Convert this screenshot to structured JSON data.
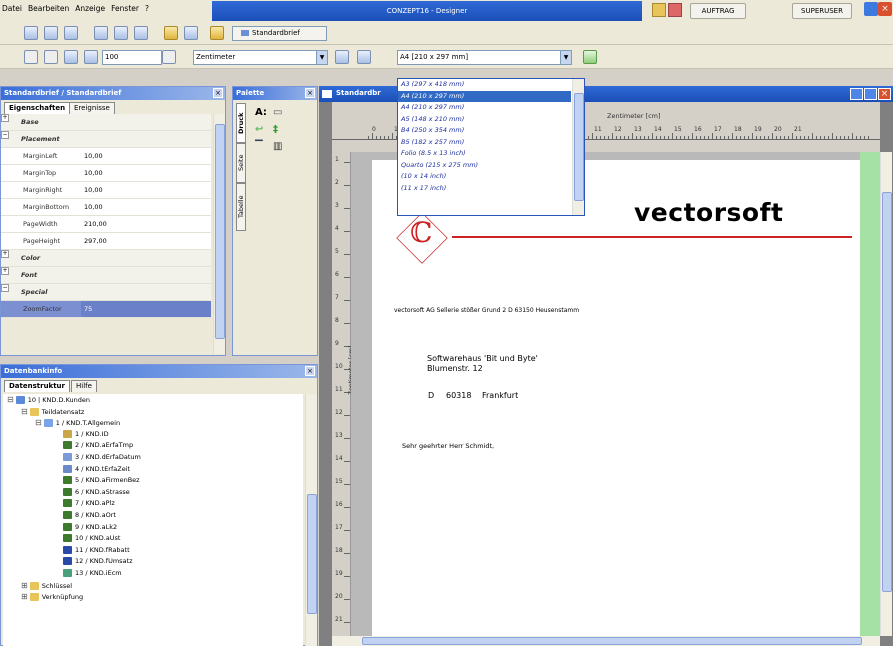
{
  "menu": [
    "Datei",
    "Bearbeiten",
    "Anzeige",
    "Fenster",
    "?"
  ],
  "app_title": "CONZEPT16 - Designer",
  "title_buttons": {
    "auftrag": "AUFTRAG",
    "superuser": "SUPERUSER"
  },
  "toolbar1": {
    "doc_selector": "Standardbrief"
  },
  "toolbar2": {
    "zoom": "100",
    "unit": "Zentimeter",
    "paper_format": "A4 [210 x 297 mm]"
  },
  "paper_dropdown": {
    "options": [
      "A3 (297 x 418 mm)",
      "A4 (210 x 297 mm)",
      "A4 (210 x 297 mm)",
      "A5 (148 x 210 mm)",
      "B4 (250 x 354 mm)",
      "B5 (182 x 257 mm)",
      "Folio (8.5 x 13 inch)",
      "Quarto (215 x 275 mm)",
      "(10 x 14 inch)",
      "(11 x 17 inch)"
    ],
    "selected_index": 1
  },
  "properties_panel": {
    "title": "Standardbrief / Standardbrief",
    "tabs": [
      "Eigenschaften",
      "Ereignisse"
    ],
    "rows": [
      {
        "key": "Base",
        "value": "",
        "type": "cat",
        "expander": "+"
      },
      {
        "key": "Placement",
        "value": "",
        "type": "cat",
        "expander": "−"
      },
      {
        "key": "MarginLeft",
        "value": "10,00",
        "type": "prop"
      },
      {
        "key": "MarginTop",
        "value": "10,00",
        "type": "prop"
      },
      {
        "key": "MarginRight",
        "value": "10,00",
        "type": "prop"
      },
      {
        "key": "MarginBottom",
        "value": "10,00",
        "type": "prop"
      },
      {
        "key": "PageWidth",
        "value": "210,00",
        "type": "prop"
      },
      {
        "key": "PageHeight",
        "value": "297,00",
        "type": "prop"
      },
      {
        "key": "Color",
        "value": "",
        "type": "cat",
        "expander": "+"
      },
      {
        "key": "Font",
        "value": "",
        "type": "cat",
        "expander": "+"
      },
      {
        "key": "Special",
        "value": "",
        "type": "cat",
        "expander": "−"
      },
      {
        "key": "ZoomFactor",
        "value": "75",
        "type": "sel"
      }
    ]
  },
  "palette_panel": {
    "title": "Palette",
    "vtabs": [
      "Druck",
      "Seite",
      "Tabelle"
    ],
    "tools": [
      "A:",
      "▭",
      "↩",
      "‡",
      "▔",
      "▥"
    ]
  },
  "db_panel": {
    "title": "Datenbankinfo",
    "tabs": [
      "Datenstruktur",
      "Hilfe"
    ],
    "tree": [
      {
        "label": "10 | KND.D.Kunden",
        "indent": 0,
        "exp": "⊟",
        "icon": "db"
      },
      {
        "label": "Teildatensatz",
        "indent": 1,
        "exp": "⊟",
        "icon": "folder"
      },
      {
        "label": "1 / KND.T.Allgemein",
        "indent": 2,
        "exp": "⊟",
        "icon": "table"
      },
      {
        "label": "1 / KND.ID",
        "indent": 4,
        "exp": "",
        "icon": "key"
      },
      {
        "label": "2 / KND.aErfaTmp",
        "indent": 4,
        "exp": "",
        "icon": "alpha"
      },
      {
        "label": "3 / KND.dErfaDatum",
        "indent": 4,
        "exp": "",
        "icon": "cal"
      },
      {
        "label": "4 / KND.tErfaZeit",
        "indent": 4,
        "exp": "",
        "icon": "clock"
      },
      {
        "label": "5 / KND.aFirmenBez",
        "indent": 4,
        "exp": "",
        "icon": "alpha"
      },
      {
        "label": "6 / KND.aStrasse",
        "indent": 4,
        "exp": "",
        "icon": "alpha"
      },
      {
        "label": "7 / KND.aPlz",
        "indent": 4,
        "exp": "",
        "icon": "alpha"
      },
      {
        "label": "8 / KND.aOrt",
        "indent": 4,
        "exp": "",
        "icon": "alpha"
      },
      {
        "label": "9 / KND.aLk2",
        "indent": 4,
        "exp": "",
        "icon": "alpha"
      },
      {
        "label": "10 / KND.aUst",
        "indent": 4,
        "exp": "",
        "icon": "alpha"
      },
      {
        "label": "11 / KND.fRabatt",
        "indent": 4,
        "exp": "",
        "icon": "num"
      },
      {
        "label": "12 / KND.fUmsatz",
        "indent": 4,
        "exp": "",
        "icon": "num"
      },
      {
        "label": "13 / KND.iEcm",
        "indent": 4,
        "exp": "",
        "icon": "int"
      },
      {
        "label": "Schlüssel",
        "indent": 1,
        "exp": "⊞",
        "icon": "folder"
      },
      {
        "label": "Verknüpfung",
        "indent": 1,
        "exp": "⊞",
        "icon": "folder"
      }
    ]
  },
  "designer": {
    "title": "Standardbr",
    "ruler_unit": "Zentimeter [cm]",
    "ruler_unit_left": "Zentimeter [cm]",
    "top_ticks": [
      "0",
      "1",
      "11",
      "12",
      "13",
      "14",
      "15",
      "16",
      "17",
      "18",
      "19",
      "20",
      "21"
    ],
    "left_ticks": [
      "1",
      "2",
      "3",
      "4",
      "5",
      "6",
      "7",
      "8",
      "9",
      "10",
      "11",
      "12",
      "13",
      "14",
      "15",
      "16",
      "17",
      "18",
      "19",
      "20",
      "21"
    ],
    "page": {
      "logo_text": "vectorsoft",
      "logo_mark": "ℂ",
      "sender_line": "vectorsoft AG   Sellerie stößer Grund 2    D    63150  Heusenstamm",
      "recipient_name": "Softwarehaus 'Bit und Byte'",
      "recipient_street": "Blumenstr. 12",
      "recipient_country": "D",
      "recipient_zip": "60318",
      "recipient_city": "Frankfurt",
      "salutation": "Sehr geehrter Herr Schmidt,"
    }
  }
}
